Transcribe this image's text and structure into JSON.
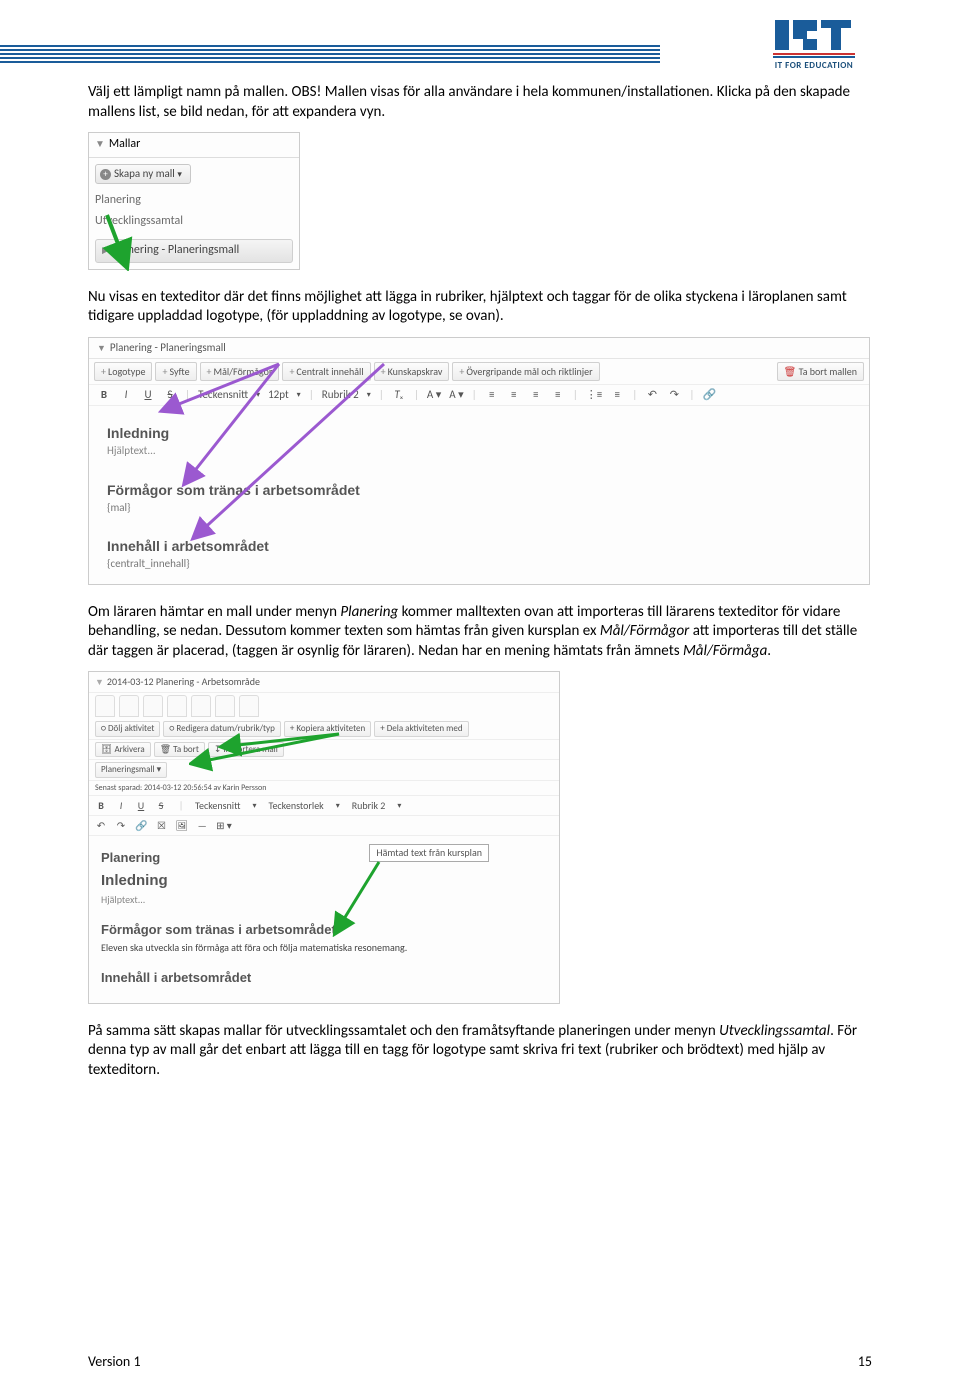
{
  "logo": {
    "tagline": "IT FOR EDUCATION"
  },
  "para1": "Välj ett lämpligt namn på mallen. OBS! Mallen visas för alla användare i hela kommunen/installationen. Klicka på den skapade mallens list, se bild nedan, för att expandera vyn.",
  "ss1": {
    "header": "Mallar",
    "create": "Skapa ny mall",
    "link1": "Planering",
    "link2": "Utvecklingssamtal",
    "selected": "Planering - Planeringsmall"
  },
  "para2": "Nu visas en texteditor där det finns möjlighet att lägga in rubriker, hjälptext och taggar för de olika styckena i läroplanen samt tidigare uppladdad logotype, (för uppladdning av logotype, se ovan).",
  "ss2": {
    "title": "Planering - Planeringsmall",
    "btns": [
      "Logotype",
      "Syfte",
      "Mål/Förmågor",
      "Centralt innehåll",
      "Kunskapskrav",
      "Övergripande mål och riktlinjer"
    ],
    "delete": "Ta bort mallen",
    "font": "Teckensnitt",
    "size": "12pt",
    "style": "Rubrik 2",
    "h1": "Inledning",
    "hint": "Hjälptext...",
    "h2": "Förmågor som tränas i arbetsområdet",
    "tag1": "{mal}",
    "h3": "Innehåll i arbetsområdet",
    "tag2": "{centralt_innehall}"
  },
  "para3a": "Om läraren hämtar en mall under menyn ",
  "para3i1": "Planering",
  "para3b": " kommer malltexten ovan att importeras till lärarens texteditor för vidare behandling, se nedan. Dessutom kommer texten som hämtas från given kursplan ex ",
  "para3i2": "Mål/Förmågor",
  "para3c": " att importeras till det ställe där taggen är placerad, (taggen är osynlig för läraren). Nedan har en mening hämtats från ämnets ",
  "para3i3": "Mål/Förmåga",
  "para3d": ".",
  "ss3": {
    "hdr": "2014-03-12 Planering - Arbetsområde",
    "pills1": [
      "Dölj aktivitet",
      "Redigera datum/rubrik/typ",
      "Kopiera aktiviteten",
      "Dela aktiviteten med"
    ],
    "pills2": [
      "Arkivera",
      "Ta bort",
      "Importera mall"
    ],
    "template": "Planeringsmall",
    "saved": "Senast sparad: 2014-03-12 20:56:54 av Karin Persson",
    "font": "Teckensnitt",
    "size": "Teckenstorlek",
    "style": "Rubrik 2",
    "h_plan": "Planering",
    "h_inl": "Inledning",
    "hint": "Hjälptext...",
    "h_form": "Förmågor som tränas i arbetsområdet",
    "sentence": "Eleven ska utveckla sin förmåga att föra och följa matematiska resonemang.",
    "h_inn": "Innehåll i arbetsområdet",
    "callout": "Hämtad text från kursplan"
  },
  "para4a": "På samma sätt skapas mallar för utvecklingssamtalet och den framåtsyftande planeringen under menyn ",
  "para4i": "Utvecklingssamtal",
  "para4b": ". För denna typ av mall går det enbart att lägga till en tagg för logotype samt skriva fri text (rubriker och brödtext) med hjälp av texteditorn.",
  "footer": {
    "version": "Version 1",
    "page": "15"
  }
}
